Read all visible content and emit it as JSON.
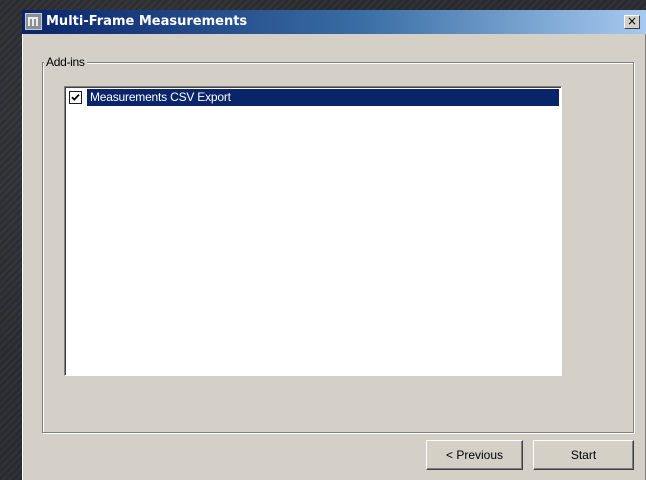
{
  "window": {
    "title": "Multi-Frame Measurements",
    "app_icon": "app-logo-icon",
    "close_glyph": "×"
  },
  "addins": {
    "group_label": "Add-ins",
    "items": [
      {
        "label": "Measurements CSV Export",
        "checked": true,
        "selected": true
      }
    ]
  },
  "buttons": {
    "previous_label": "< Previous",
    "start_label": "Start"
  },
  "colors": {
    "selection": "#0a246a",
    "dialog_face": "#d4d0c8",
    "titlebar_start": "#0a246a",
    "titlebar_end": "#a6caf0"
  }
}
